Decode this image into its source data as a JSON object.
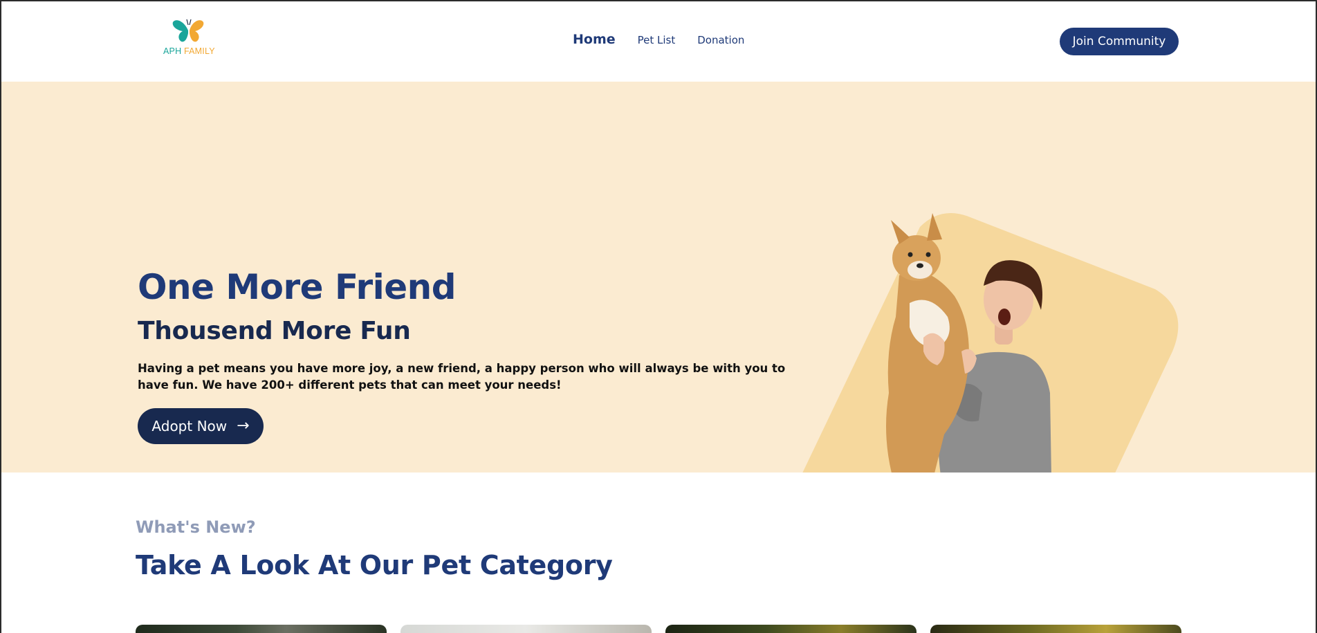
{
  "brand": {
    "name_part1": "APH",
    "name_part2": "FAMILY",
    "colors": {
      "teal": "#1aa59a",
      "orange": "#f2a833"
    }
  },
  "nav": {
    "items": [
      {
        "label": "Home",
        "active": true
      },
      {
        "label": "Pet List",
        "active": false
      },
      {
        "label": "Donation",
        "active": false
      }
    ]
  },
  "header": {
    "cta_label": "Join Community"
  },
  "hero": {
    "title": "One More Friend",
    "subtitle": "Thousend More Fun",
    "description": "Having a pet means you have more joy, a new friend, a happy person who will always be with you to have fun. We have 200+ different pets that can meet your needs!",
    "cta_label": "Adopt Now",
    "cta_icon": "arrow-right-icon",
    "image": "woman-holding-corgi-illustration"
  },
  "section": {
    "kicker": "What's New?",
    "title": "Take A Look At Our Pet Category",
    "cards": [
      "pet-category-card-1",
      "pet-category-card-2",
      "pet-category-card-3",
      "pet-category-card-4"
    ]
  },
  "colors": {
    "primary": "#1f3a78",
    "dark_navy": "#18294f",
    "hero_bg": "#fbebd1",
    "kicker": "#8f9bb7"
  }
}
